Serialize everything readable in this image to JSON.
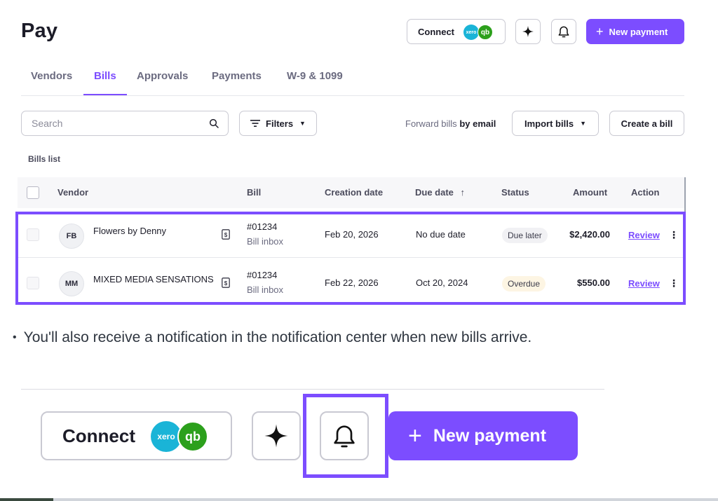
{
  "page": {
    "title": "Pay"
  },
  "header": {
    "connect_label": "Connect",
    "xero_label": "xero",
    "qb_label": "qb",
    "new_payment_label": "New payment"
  },
  "tabs": [
    {
      "label": "Vendors",
      "active": false
    },
    {
      "label": "Bills",
      "active": true
    },
    {
      "label": "Approvals",
      "active": false
    },
    {
      "label": "Payments",
      "active": false
    },
    {
      "label": "W-9 & 1099",
      "active": false
    }
  ],
  "toolbar": {
    "search_placeholder": "Search",
    "filters_label": "Filters",
    "forward_prefix": "Forward bills",
    "forward_bold": "by email",
    "import_label": "Import bills",
    "create_label": "Create a bill"
  },
  "bills": {
    "list_label": "Bills list",
    "columns": {
      "vendor": "Vendor",
      "bill": "Bill",
      "creation_date": "Creation date",
      "due_date": "Due date",
      "due_sort": "↑",
      "status": "Status",
      "amount": "Amount",
      "action": "Action"
    },
    "rows": [
      {
        "initials": "FB",
        "vendor": "Flowers by Denny",
        "bill_number": "#01234",
        "bill_source": "Bill inbox",
        "creation_date": "Feb 20, 2026",
        "due_date": "No due date",
        "status": "Due later",
        "amount": "$2,420.00",
        "action": "Review"
      },
      {
        "initials": "MM",
        "vendor": "MIXED MEDIA SENSATIONS",
        "bill_number": "#01234",
        "bill_source": "Bill inbox",
        "creation_date": "Feb 22, 2026",
        "due_date": "Oct 20, 2024",
        "status": "Overdue",
        "amount": "$550.00",
        "action": "Review"
      }
    ],
    "kebab": "⋮"
  },
  "note": {
    "bullet": "•",
    "text": "You'll also receive a notification in the notification center when new bills arrive."
  },
  "zoom": {
    "connect_label": "Connect",
    "xero_label": "xero",
    "qb_label": "qb",
    "new_payment_label": "New payment"
  },
  "colors": {
    "accent": "#7c4dff",
    "xero": "#1ab4d7",
    "quickbooks": "#2ca01c",
    "overdue_badge": "#fdf5e3"
  },
  "icons": [
    "sparkle-icon",
    "bell-icon",
    "plus-icon",
    "search-icon",
    "filter-icon",
    "caret-down-icon",
    "document-dollar-icon",
    "kebab-menu-icon",
    "sort-up-icon"
  ]
}
